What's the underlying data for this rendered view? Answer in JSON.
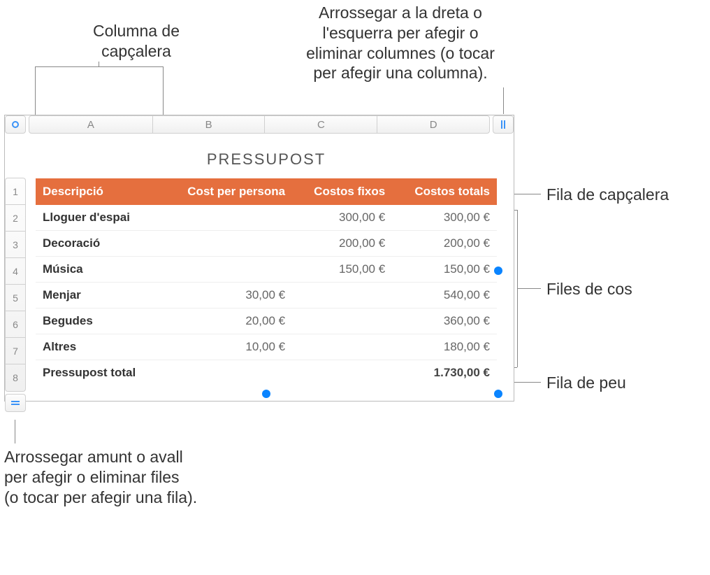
{
  "callouts": {
    "header_column_l1": "Columna de",
    "header_column_l2": "capçalera",
    "drag_cols_l1": "Arrossegar a la dreta o",
    "drag_cols_l2": "l'esquerra per afegir o",
    "drag_cols_l3": "eliminar columnes (o tocar",
    "drag_cols_l4": "per afegir una columna).",
    "header_row": "Fila de capçalera",
    "body_rows": "Files de cos",
    "footer_row": "Fila de peu",
    "drag_rows_l1": "Arrossegar amunt o avall",
    "drag_rows_l2": "per afegir o eliminar files",
    "drag_rows_l3": "(o tocar per afegir una fila)."
  },
  "spreadsheet": {
    "columns": [
      "A",
      "B",
      "C",
      "D"
    ],
    "rows": [
      "1",
      "2",
      "3",
      "4",
      "5",
      "6",
      "7",
      "8"
    ],
    "title": "PRESSUPOST",
    "headers": [
      "Descripció",
      "Cost per persona",
      "Costos fixos",
      "Costos totals"
    ],
    "body": [
      {
        "desc": "Lloguer d'espai",
        "per": "",
        "fix": "300,00 €",
        "tot": "300,00 €"
      },
      {
        "desc": "Decoració",
        "per": "",
        "fix": "200,00 €",
        "tot": "200,00 €"
      },
      {
        "desc": "Música",
        "per": "",
        "fix": "150,00 €",
        "tot": "150,00 €"
      },
      {
        "desc": "Menjar",
        "per": "30,00 €",
        "fix": "",
        "tot": "540,00 €"
      },
      {
        "desc": "Begudes",
        "per": "20,00 €",
        "fix": "",
        "tot": "360,00 €"
      },
      {
        "desc": "Altres",
        "per": "10,00 €",
        "fix": "",
        "tot": "180,00 €"
      }
    ],
    "footer": {
      "desc": "Pressupost total",
      "per": "",
      "fix": "",
      "tot": "1.730,00 €"
    }
  }
}
